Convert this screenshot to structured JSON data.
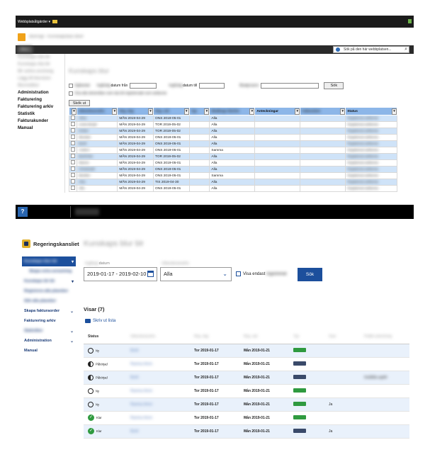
{
  "old_ui": {
    "topbar": {
      "label": "Webbplatsåtgärder ▾"
    },
    "breadcrumb": "Blurrogr › Kunskapsbas Blurr",
    "ribbon": {
      "tab": "Blurr",
      "search_placeholder": "Sök på den här webbplatsen..."
    },
    "sidebar": [
      {
        "label": "Kunskaps bla blr",
        "blurred": true
      },
      {
        "label": "Kunskaps bla blr",
        "blurred": true
      },
      {
        "label": "Blr avbra avstrang",
        "blurred": true
      },
      {
        "label": "Lägg till blurstom",
        "blurred": true
      },
      {
        "label": "Blurredblur",
        "blurred": true
      },
      {
        "label": "Administration",
        "blurred": false
      },
      {
        "label": "Fakturering",
        "blurred": false
      },
      {
        "label": "Fakturering arkiv",
        "blurred": false
      },
      {
        "label": "Statistik",
        "blurred": false
      },
      {
        "label": "Fakturakunder",
        "blurred": false
      },
      {
        "label": "Manual",
        "blurred": false
      }
    ],
    "page_title": "Kunskaps blur",
    "filter": {
      "checkbox1": "Ogblurlad",
      "from_prefix": "Ingårdag",
      "from_label": "datum från",
      "to_prefix": "Ingårdag",
      "to_label": "datum till",
      "third_label": "Bludgrnaren",
      "search_btn": "Sök"
    },
    "checkbox2": "Visa alla ämnenblur som ska bli registrerade som avblurrat",
    "sokut_btn": "Skök ut",
    "columns": [
      "",
      "Uttansbvarssfra",
      "Reg. dag",
      "Reg. svk",
      "Typ",
      "Bladbugs blurlnn",
      "Anteckningar",
      "Fakturalom",
      "Status"
    ],
    "rows": [
      {
        "name": "Alma",
        "reg": "MÅN 2019-04-29",
        "svk": "ONS 2019-05-01",
        "omr": "Alla"
      },
      {
        "name": "Linda Bergh",
        "reg": "MÅN 2019-04-29",
        "svk": "TOR 2019-05-02",
        "omr": "Alla"
      },
      {
        "name": "Krister",
        "reg": "MÅN 2019-04-29",
        "svk": "TOR 2019-05-02",
        "omr": "Alla"
      },
      {
        "name": "Blurdad",
        "reg": "MÅN 2019-04-29",
        "svk": "ONS 2019-05-01",
        "omr": "Alla"
      },
      {
        "name": "Bertil",
        "reg": "MÅN 2019-04-29",
        "svk": "ONS 2019-05-01",
        "omr": "Alla"
      },
      {
        "name": "Anders",
        "reg": "MÅN 2019-04-29",
        "svk": "ONS 2019-05-01",
        "omr": "Samma"
      },
      {
        "name": "Bertil blur",
        "reg": "MÅN 2019-04-29",
        "svk": "TOR 2019-05-02",
        "omr": "Alla"
      },
      {
        "name": "Manne",
        "reg": "MÅN 2019-04-29",
        "svk": "ONS 2019-05-01",
        "omr": "Alla"
      },
      {
        "name": "Christinabl",
        "reg": "MÅN 2019-04-29",
        "svk": "ONS 2019-05-01",
        "omr": "Alla"
      },
      {
        "name": "Blurbler",
        "reg": "MÅN 2019-04-29",
        "svk": "ONS 2019-05-01",
        "omr": "Samma"
      },
      {
        "name": "Alsa",
        "reg": "MÅN 2019-04-29",
        "svk": "TIS 2019-04-30",
        "omr": "Alla"
      },
      {
        "name": "Olle",
        "reg": "MÅN 2019-04-29",
        "svk": "ONS 2019-05-01",
        "omr": "Alla"
      }
    ],
    "status_blur": "Registrerat avblurrat"
  },
  "new_ui": {
    "topbar": {
      "help": "?",
      "title": "Blurb"
    },
    "logo": "Regeringskansliet",
    "nav": [
      {
        "label": "Kunskaps blur blr",
        "active": true,
        "blurred": true,
        "chev": "▾",
        "sub": false
      },
      {
        "label": "Skapa extra avrastning",
        "active": false,
        "blurred": true,
        "chev": "",
        "sub": true
      },
      {
        "label": "Kunskaps blr blr",
        "active": false,
        "blurred": true,
        "chev": "▾",
        "sub": false
      },
      {
        "label": "Registrera alla planeber",
        "active": false,
        "blurred": true,
        "chev": "",
        "sub": false
      },
      {
        "label": "Sök alla planeber",
        "active": false,
        "blurred": true,
        "chev": "",
        "sub": false
      },
      {
        "label": "Skapa fakturaorder",
        "active": false,
        "blurred": false,
        "chev": "⌄",
        "sub": false
      },
      {
        "label": "Fakturering arkiv",
        "active": false,
        "blurred": false,
        "chev": "",
        "sub": false
      },
      {
        "label": "Statistiker",
        "active": false,
        "blurred": true,
        "chev": "⌄",
        "sub": false
      },
      {
        "label": "Administration",
        "active": false,
        "blurred": false,
        "chev": "⌄",
        "sub": false
      },
      {
        "label": "Manual",
        "active": false,
        "blurred": false,
        "chev": "",
        "sub": false
      }
    ],
    "page_title": "Kunskaps blur blr",
    "date_label_prefix": "Ingångs",
    "date_label": "datum",
    "type_label": "Uttansbvarssfra",
    "date_value": "2019-01-17 - 2019-02-10",
    "select_value": "Alla",
    "visa_label": "Visa endast",
    "visa_blur": "registrerad",
    "search_btn": "Sök",
    "visar": "Visar (7)",
    "print": "Skriv ut lista",
    "columns": [
      "Status",
      "Uttansbvarssfra",
      "Reg. dag",
      "Reg. avk",
      "Typ",
      "Svar",
      "Publik anteckning"
    ],
    "rows": [
      {
        "status": "empty",
        "status_label": "Ny",
        "name": "Bertil",
        "reg": "Tor 2019-01-17",
        "avk": "Mån 2019-01-21",
        "tag": "green",
        "svar": "",
        "note": ""
      },
      {
        "status": "half",
        "status_label": "Påbörjad",
        "name": "Rasmus Annn",
        "reg": "Tor 2019-01-17",
        "avk": "Mån 2019-01-21",
        "tag": "dark",
        "svar": "",
        "note": ""
      },
      {
        "status": "half",
        "status_label": "Påbörjad",
        "name": "Bertil",
        "reg": "Tor 2019-01-17",
        "avk": "Mån 2019-01-21",
        "tag": "dark",
        "svar": "",
        "note": "Inställda uppfrr"
      },
      {
        "status": "empty",
        "status_label": "Ny",
        "name": "Rasmus Annn",
        "reg": "Tor 2019-01-17",
        "avk": "Mån 2019-01-21",
        "tag": "green",
        "svar": "",
        "note": ""
      },
      {
        "status": "empty",
        "status_label": "Ny",
        "name": "Rasmus Annn",
        "reg": "Tor 2019-01-17",
        "avk": "Mån 2019-01-21",
        "tag": "green",
        "svar": "Ja",
        "note": ""
      },
      {
        "status": "done",
        "status_label": "Klar",
        "name": "Rasmus Annn",
        "reg": "Tor 2019-01-17",
        "avk": "Mån 2019-01-21",
        "tag": "green",
        "svar": "",
        "note": ""
      },
      {
        "status": "done",
        "status_label": "Klar",
        "name": "Bertil",
        "reg": "Tor 2019-01-17",
        "avk": "Mån 2019-01-21",
        "tag": "dark",
        "svar": "Ja",
        "note": ""
      }
    ]
  }
}
